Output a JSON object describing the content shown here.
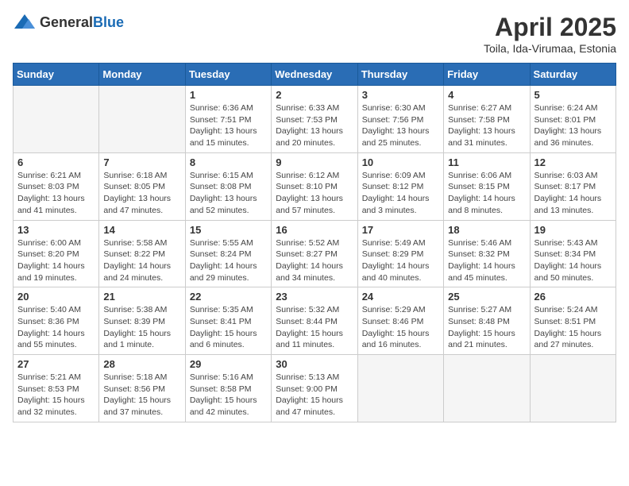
{
  "logo": {
    "general": "General",
    "blue": "Blue"
  },
  "header": {
    "month": "April 2025",
    "location": "Toila, Ida-Virumaa, Estonia"
  },
  "weekdays": [
    "Sunday",
    "Monday",
    "Tuesday",
    "Wednesday",
    "Thursday",
    "Friday",
    "Saturday"
  ],
  "weeks": [
    [
      {
        "day": "",
        "info": ""
      },
      {
        "day": "",
        "info": ""
      },
      {
        "day": "1",
        "info": "Sunrise: 6:36 AM\nSunset: 7:51 PM\nDaylight: 13 hours and 15 minutes."
      },
      {
        "day": "2",
        "info": "Sunrise: 6:33 AM\nSunset: 7:53 PM\nDaylight: 13 hours and 20 minutes."
      },
      {
        "day": "3",
        "info": "Sunrise: 6:30 AM\nSunset: 7:56 PM\nDaylight: 13 hours and 25 minutes."
      },
      {
        "day": "4",
        "info": "Sunrise: 6:27 AM\nSunset: 7:58 PM\nDaylight: 13 hours and 31 minutes."
      },
      {
        "day": "5",
        "info": "Sunrise: 6:24 AM\nSunset: 8:01 PM\nDaylight: 13 hours and 36 minutes."
      }
    ],
    [
      {
        "day": "6",
        "info": "Sunrise: 6:21 AM\nSunset: 8:03 PM\nDaylight: 13 hours and 41 minutes."
      },
      {
        "day": "7",
        "info": "Sunrise: 6:18 AM\nSunset: 8:05 PM\nDaylight: 13 hours and 47 minutes."
      },
      {
        "day": "8",
        "info": "Sunrise: 6:15 AM\nSunset: 8:08 PM\nDaylight: 13 hours and 52 minutes."
      },
      {
        "day": "9",
        "info": "Sunrise: 6:12 AM\nSunset: 8:10 PM\nDaylight: 13 hours and 57 minutes."
      },
      {
        "day": "10",
        "info": "Sunrise: 6:09 AM\nSunset: 8:12 PM\nDaylight: 14 hours and 3 minutes."
      },
      {
        "day": "11",
        "info": "Sunrise: 6:06 AM\nSunset: 8:15 PM\nDaylight: 14 hours and 8 minutes."
      },
      {
        "day": "12",
        "info": "Sunrise: 6:03 AM\nSunset: 8:17 PM\nDaylight: 14 hours and 13 minutes."
      }
    ],
    [
      {
        "day": "13",
        "info": "Sunrise: 6:00 AM\nSunset: 8:20 PM\nDaylight: 14 hours and 19 minutes."
      },
      {
        "day": "14",
        "info": "Sunrise: 5:58 AM\nSunset: 8:22 PM\nDaylight: 14 hours and 24 minutes."
      },
      {
        "day": "15",
        "info": "Sunrise: 5:55 AM\nSunset: 8:24 PM\nDaylight: 14 hours and 29 minutes."
      },
      {
        "day": "16",
        "info": "Sunrise: 5:52 AM\nSunset: 8:27 PM\nDaylight: 14 hours and 34 minutes."
      },
      {
        "day": "17",
        "info": "Sunrise: 5:49 AM\nSunset: 8:29 PM\nDaylight: 14 hours and 40 minutes."
      },
      {
        "day": "18",
        "info": "Sunrise: 5:46 AM\nSunset: 8:32 PM\nDaylight: 14 hours and 45 minutes."
      },
      {
        "day": "19",
        "info": "Sunrise: 5:43 AM\nSunset: 8:34 PM\nDaylight: 14 hours and 50 minutes."
      }
    ],
    [
      {
        "day": "20",
        "info": "Sunrise: 5:40 AM\nSunset: 8:36 PM\nDaylight: 14 hours and 55 minutes."
      },
      {
        "day": "21",
        "info": "Sunrise: 5:38 AM\nSunset: 8:39 PM\nDaylight: 15 hours and 1 minute."
      },
      {
        "day": "22",
        "info": "Sunrise: 5:35 AM\nSunset: 8:41 PM\nDaylight: 15 hours and 6 minutes."
      },
      {
        "day": "23",
        "info": "Sunrise: 5:32 AM\nSunset: 8:44 PM\nDaylight: 15 hours and 11 minutes."
      },
      {
        "day": "24",
        "info": "Sunrise: 5:29 AM\nSunset: 8:46 PM\nDaylight: 15 hours and 16 minutes."
      },
      {
        "day": "25",
        "info": "Sunrise: 5:27 AM\nSunset: 8:48 PM\nDaylight: 15 hours and 21 minutes."
      },
      {
        "day": "26",
        "info": "Sunrise: 5:24 AM\nSunset: 8:51 PM\nDaylight: 15 hours and 27 minutes."
      }
    ],
    [
      {
        "day": "27",
        "info": "Sunrise: 5:21 AM\nSunset: 8:53 PM\nDaylight: 15 hours and 32 minutes."
      },
      {
        "day": "28",
        "info": "Sunrise: 5:18 AM\nSunset: 8:56 PM\nDaylight: 15 hours and 37 minutes."
      },
      {
        "day": "29",
        "info": "Sunrise: 5:16 AM\nSunset: 8:58 PM\nDaylight: 15 hours and 42 minutes."
      },
      {
        "day": "30",
        "info": "Sunrise: 5:13 AM\nSunset: 9:00 PM\nDaylight: 15 hours and 47 minutes."
      },
      {
        "day": "",
        "info": ""
      },
      {
        "day": "",
        "info": ""
      },
      {
        "day": "",
        "info": ""
      }
    ]
  ]
}
